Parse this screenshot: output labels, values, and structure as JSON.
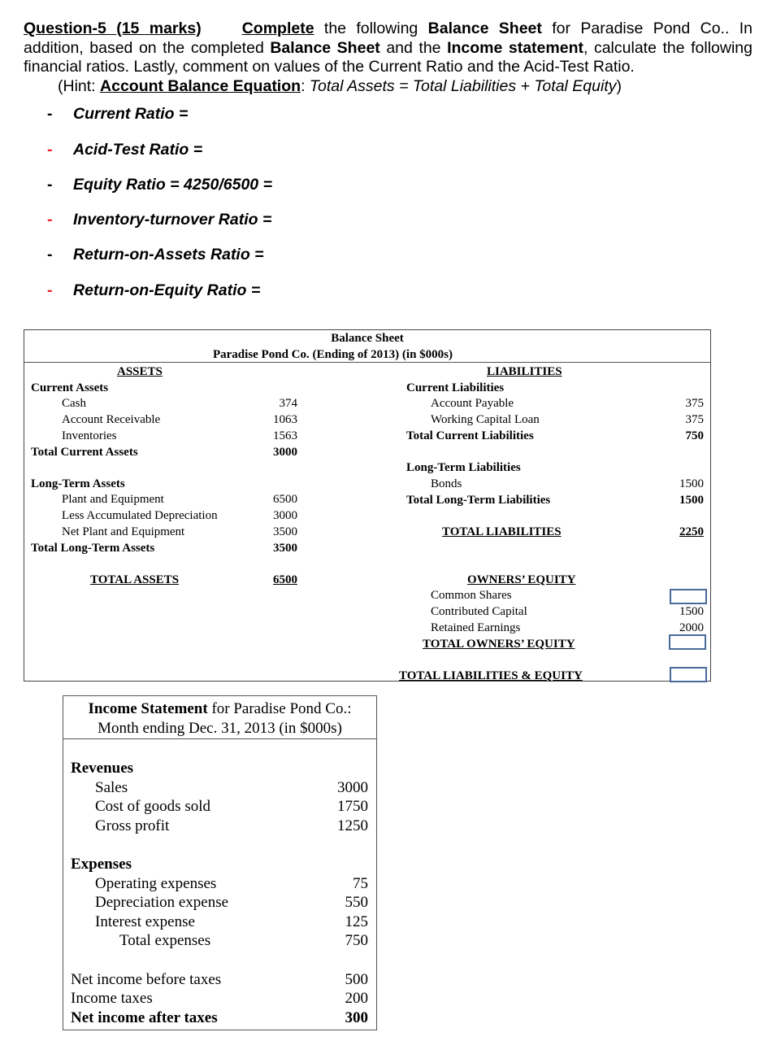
{
  "question": {
    "heading": "Question-5 (15 marks)",
    "complete_word": "Complete",
    "text_1": " the following ",
    "balance_sheet_1": "Balance Sheet",
    "text_2": " for Paradise Pond Co.. In addition, based on the completed ",
    "balance_sheet_2": "Balance Sheet",
    "text_3": " and the ",
    "income_statement": "Income statement",
    "text_4": ", calculate the following financial ratios. Lastly, comment on values of the Current Ratio and the Acid-Test Ratio.",
    "hint_open": "(Hint: ",
    "hint_label": "Account Balance Equation",
    "hint_colon": ": ",
    "hint_equation": "Total Assets = Total Liabilities + Total Equity",
    "hint_close": ")"
  },
  "ratios": [
    {
      "dash": "-",
      "dash_color": "#000000",
      "label": "Current Ratio ="
    },
    {
      "dash": "-",
      "dash_color": "#e8202a",
      "label": "Acid-Test Ratio ="
    },
    {
      "dash": "-",
      "dash_color": "#000000",
      "label": "Equity Ratio = 4250/6500 ="
    },
    {
      "dash": "-",
      "dash_color": "#e8202a",
      "label": "Inventory-turnover Ratio ="
    },
    {
      "dash": "-",
      "dash_color": "#000000",
      "label": "Return-on-Assets Ratio ="
    },
    {
      "dash": "-",
      "dash_color": "#e8202a",
      "label": "Return-on-Equity Ratio ="
    }
  ],
  "balance_sheet": {
    "title": "Balance Sheet",
    "subtitle": "Paradise Pond Co. (Ending of 2013) (in $000s)",
    "assets": {
      "heading": "ASSETS",
      "current_heading": "Current Assets",
      "current_items": [
        {
          "label": "Cash",
          "value": "374"
        },
        {
          "label": "Account Receivable",
          "value": "1063"
        },
        {
          "label": "Inventories",
          "value": "1563"
        }
      ],
      "total_current": {
        "label": "Total Current Assets",
        "value": "3000"
      },
      "long_term_heading": "Long-Term Assets",
      "long_term_items": [
        {
          "label": "Plant and Equipment",
          "value": "6500"
        },
        {
          "label": "Less Accumulated Depreciation",
          "value": "3000"
        },
        {
          "label": "Net Plant and Equipment",
          "value": "3500"
        }
      ],
      "total_long_term": {
        "label": "Total Long-Term Assets",
        "value": "3500"
      },
      "total_assets": {
        "label": "TOTAL ASSETS",
        "value": "6500"
      }
    },
    "liabilities": {
      "heading": "LIABILITIES",
      "current_heading": "Current Liabilities",
      "current_items": [
        {
          "label": "Account Payable",
          "value": "375"
        },
        {
          "label": "Working Capital Loan",
          "value": "375"
        }
      ],
      "total_current": {
        "label": "Total Current Liabilities",
        "value": "750"
      },
      "long_term_heading": "Long-Term Liabilities",
      "long_term_items": [
        {
          "label": "Bonds",
          "value": "1500"
        }
      ],
      "total_long_term": {
        "label": "Total Long-Term Liabilities",
        "value": "1500"
      },
      "total_liabilities": {
        "label": "TOTAL LIABILITIES",
        "value": "2250"
      }
    },
    "equity": {
      "heading": "OWNERS’ EQUITY",
      "items": [
        {
          "label": "Common Shares",
          "value": ""
        },
        {
          "label": "Contributed Capital",
          "value": "1500"
        },
        {
          "label": "Retained Earnings",
          "value": "2000"
        }
      ],
      "total_equity": {
        "label": "TOTAL OWNERS’ EQUITY",
        "value": ""
      },
      "total_liabilities_equity": {
        "label": "TOTAL LIABILITIES & EQUITY",
        "value": ""
      }
    },
    "blank_box_color": "#4a6b9a"
  },
  "income_statement": {
    "title_bold": "Income Statement",
    "title_rest": " for Paradise Pond Co.:",
    "subtitle": "Month ending Dec. 31, 2013 (in $000s)",
    "revenues_heading": "Revenues",
    "revenues": [
      {
        "label": "Sales",
        "value": "3000"
      },
      {
        "label": "Cost of goods sold",
        "value": "1750"
      },
      {
        "label": "Gross profit",
        "value": "1250"
      }
    ],
    "expenses_heading": "Expenses",
    "expenses": [
      {
        "label": "Operating expenses",
        "value": "75"
      },
      {
        "label": "Depreciation expense",
        "value": "550"
      },
      {
        "label": "Interest expense",
        "value": "125"
      }
    ],
    "total_expenses": {
      "label": "Total expenses",
      "value": "750"
    },
    "net_before_taxes": {
      "label": "Net income before taxes",
      "value": "500"
    },
    "income_taxes": {
      "label": "Income taxes",
      "value": "200"
    },
    "net_after_taxes": {
      "label": "Net income after taxes",
      "value": "300"
    }
  }
}
